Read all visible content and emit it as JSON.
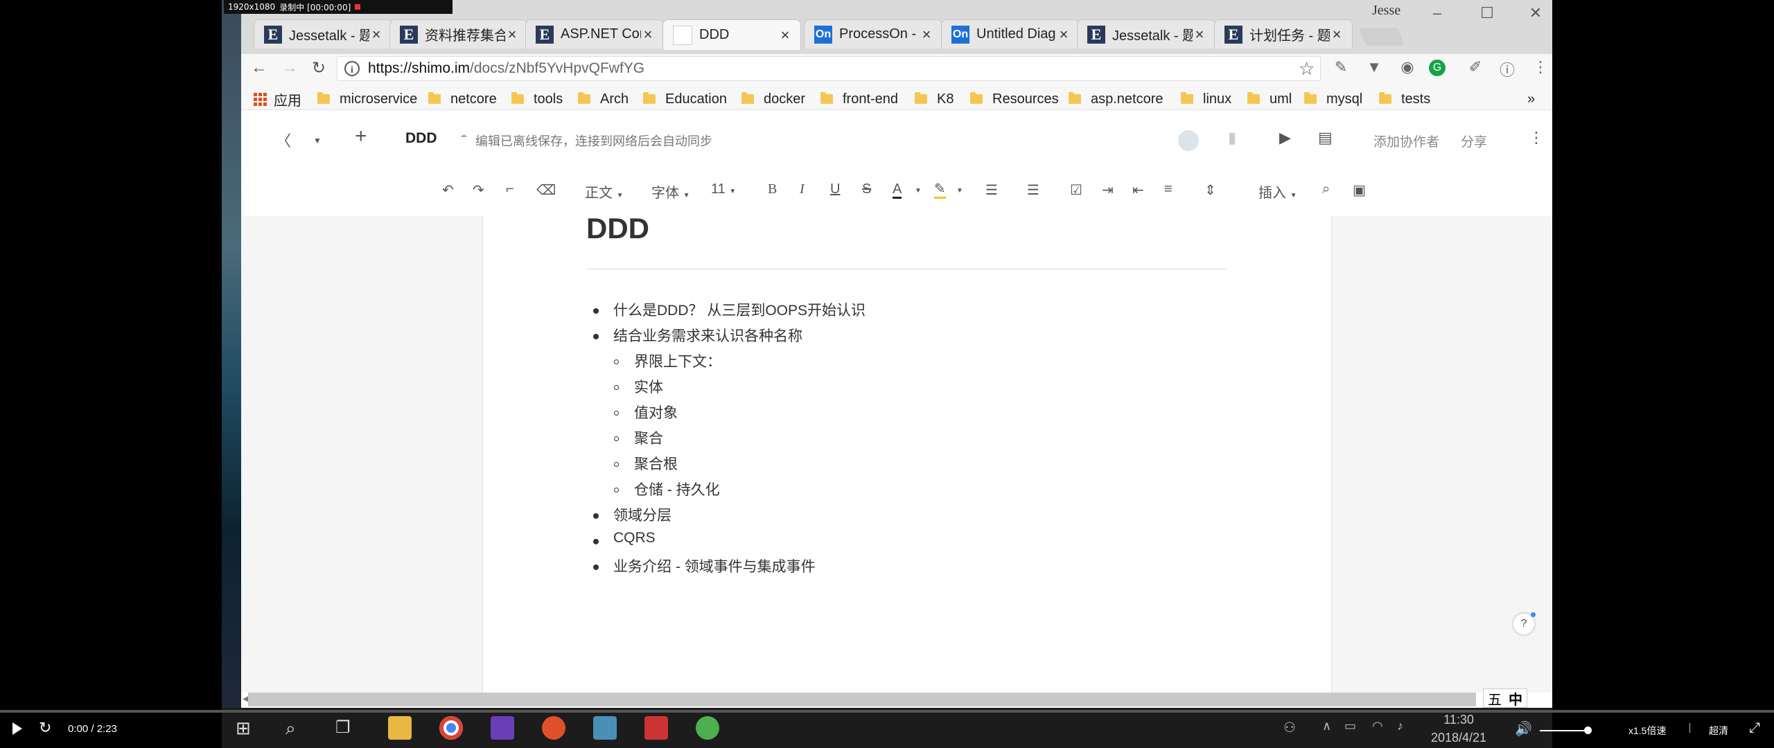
{
  "recorder": {
    "resolution": "1920x1080",
    "status": "录制中 [00:00:00]"
  },
  "window": {
    "user": "Jesse"
  },
  "tabs": [
    {
      "icon": "E",
      "label": "Jessetalk - 题",
      "active": false
    },
    {
      "icon": "E",
      "label": "资料推荐集合",
      "active": false
    },
    {
      "icon": "E",
      "label": "ASP.NET Cor",
      "active": false
    },
    {
      "icon": "doc",
      "label": "DDD",
      "active": true
    },
    {
      "icon": "On",
      "label": "ProcessOn -",
      "active": false
    },
    {
      "icon": "On",
      "label": "Untitled Diag",
      "active": false
    },
    {
      "icon": "E",
      "label": "Jessetalk - 题",
      "active": false
    },
    {
      "icon": "E",
      "label": "计划任务 - 题",
      "active": false
    }
  ],
  "address": {
    "host": "https://shimo.im",
    "path": "/docs/zNbf5YvHpvQFwfYG"
  },
  "bookmarks": {
    "apps_label": "应用",
    "items": [
      "microservice",
      "netcore",
      "tools",
      "Arch",
      "Education",
      "docker",
      "front-end",
      "K8",
      "Resources",
      "asp.netcore",
      "linux",
      "uml",
      "mysql",
      "tests"
    ],
    "more": "»"
  },
  "shimo": {
    "doc_name": "DDD",
    "save_message": "编辑已离线保存，连接到网络后会自动同步",
    "add_collaborator": "添加协作者",
    "share": "分享"
  },
  "toolbar": {
    "style": "正文",
    "font": "字体",
    "size": "11",
    "bold": "B",
    "italic": "I",
    "underline": "U",
    "strike": "S",
    "color": "A",
    "insert": "插入"
  },
  "document": {
    "title": "DDD",
    "items": [
      {
        "level": 1,
        "text": "什么是DDD？ 从三层到OOPS开始认识"
      },
      {
        "level": 1,
        "text": "结合业务需求来认识各种名称"
      },
      {
        "level": 2,
        "text": "界限上下文："
      },
      {
        "level": 2,
        "text": "实体"
      },
      {
        "level": 2,
        "text": "值对象"
      },
      {
        "level": 2,
        "text": "聚合"
      },
      {
        "level": 2,
        "text": "聚合根"
      },
      {
        "level": 2,
        "text": "仓储 - 持久化"
      },
      {
        "level": 1,
        "text": "领域分层"
      },
      {
        "level": 1,
        "text": "CQRS"
      },
      {
        "level": 1,
        "text": "业务介绍 - 领域事件与集成事件"
      }
    ]
  },
  "ime": {
    "mode1": "五",
    "mode2": "中"
  },
  "taskbar": {
    "time": "11:30",
    "date": "2018/4/21"
  },
  "player": {
    "time": "0:00 / 2:23",
    "speed": "x1.5倍速",
    "quality": "超清",
    "progress": 0.0
  }
}
